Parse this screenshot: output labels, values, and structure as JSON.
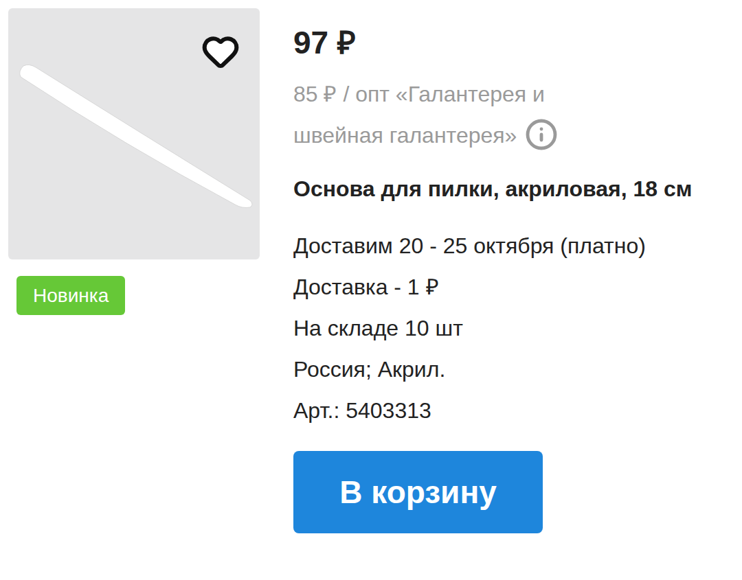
{
  "product_card": {
    "favorite": {
      "selected": false
    },
    "badge": "Новинка",
    "price": "97 ₽",
    "wholesale": "85 ₽ / опт «Галантерея и швейная галантерея»",
    "title": "Основа для пилки, акриловая, 18 см",
    "details": [
      "Доставим 20 - 25 октября (платно)",
      "Доставка - 1 ₽",
      "На складе 10 шт",
      "Россия; Акрил.",
      "Арт.: 5403313"
    ],
    "button": "В корзину"
  }
}
